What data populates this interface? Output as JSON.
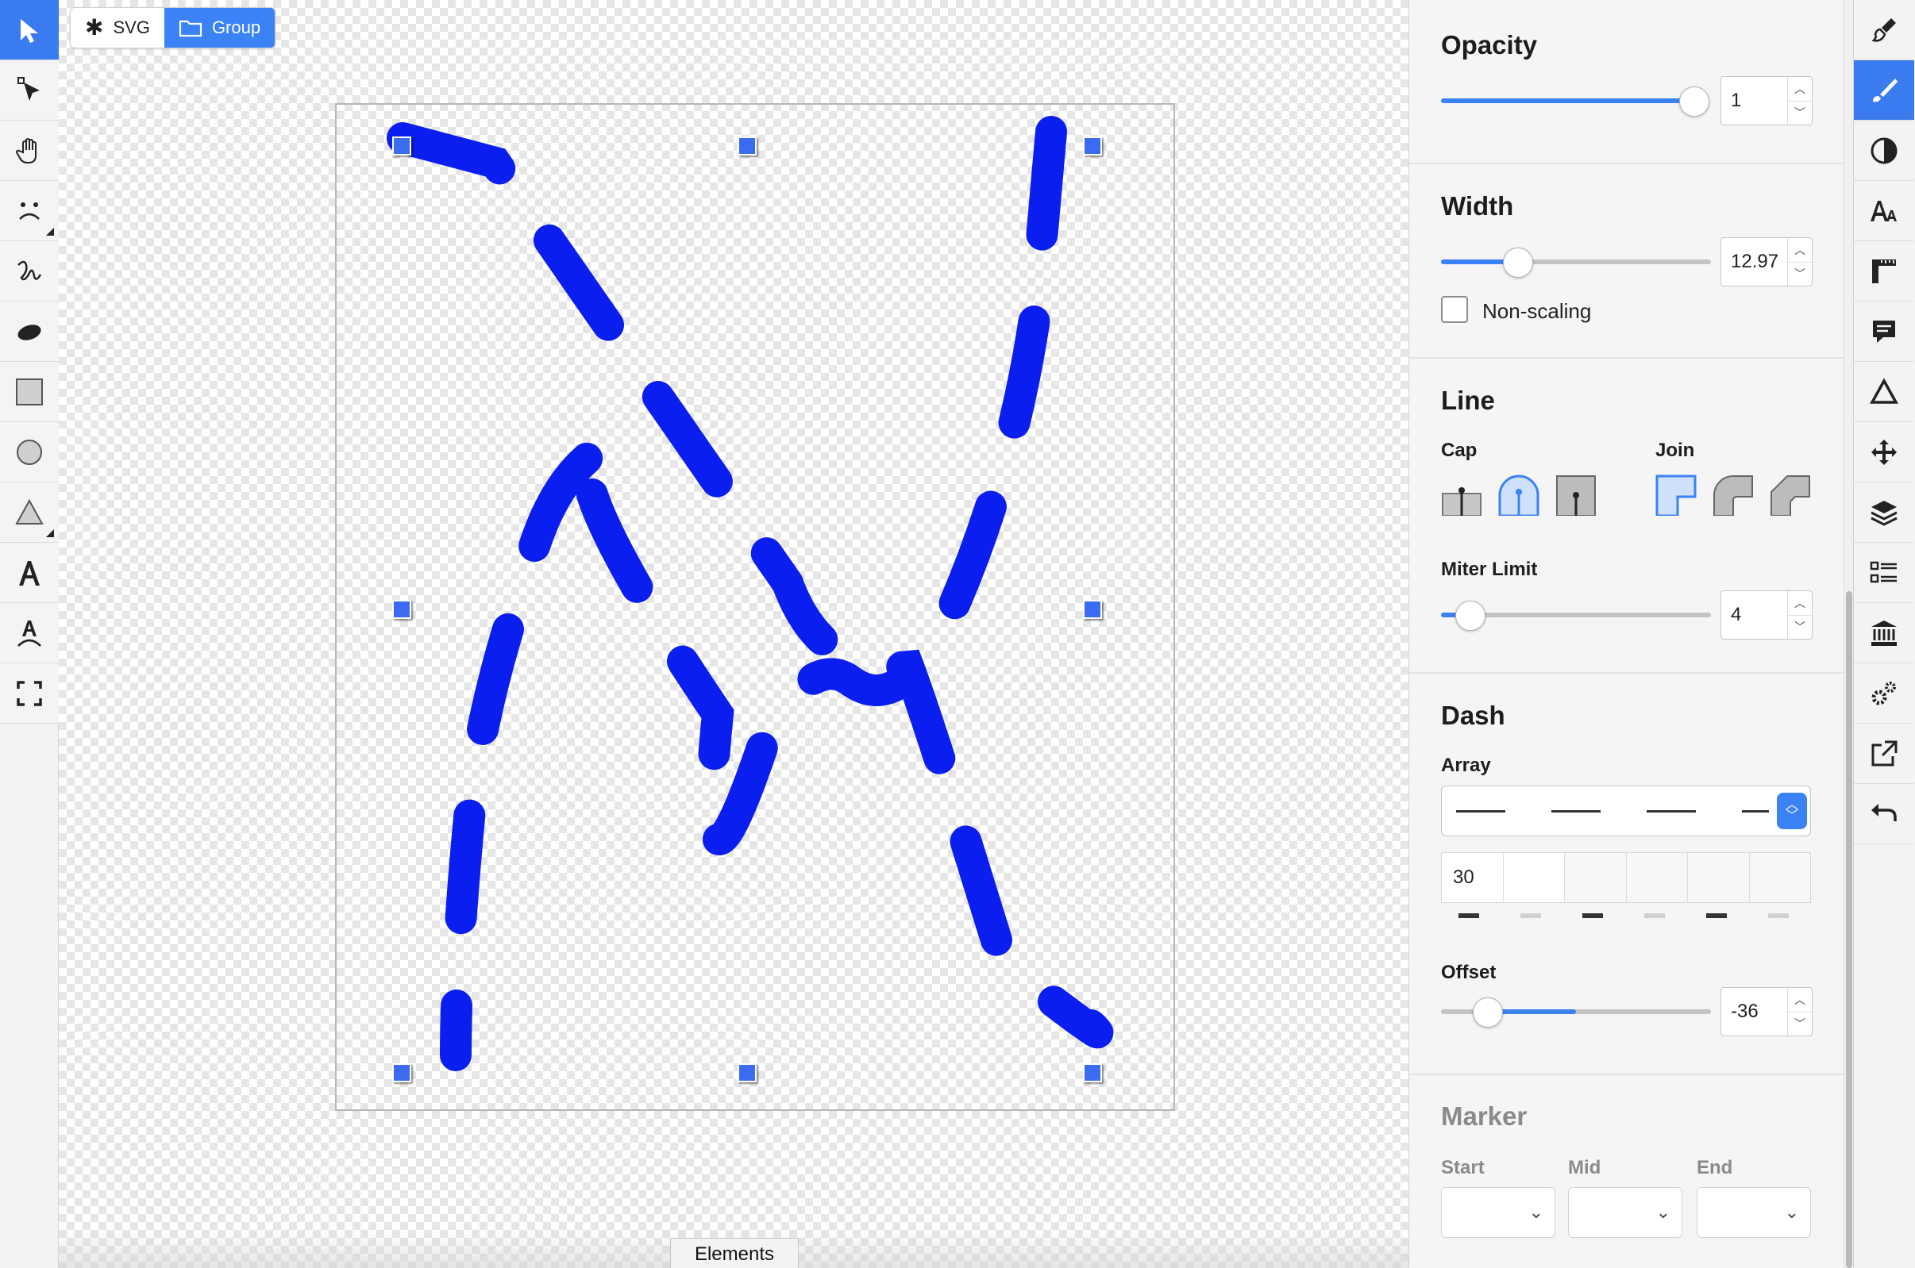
{
  "breadcrumb": {
    "svg_label": "SVG",
    "group_label": "Group"
  },
  "elements_tab": "Elements",
  "left_tools": [
    "select-arrow-icon",
    "node-select-icon",
    "hand-icon",
    "face-icon",
    "freehand-icon",
    "ellipse-icon",
    "rectangle-icon",
    "circle-icon",
    "triangle-icon",
    "text-icon",
    "text-on-path-icon",
    "fullscreen-icon"
  ],
  "right_tools": [
    "brush-fill-icon",
    "brush-stroke-icon",
    "contrast-icon",
    "font-size-icon",
    "ruler-icon",
    "comment-icon",
    "delta-icon",
    "move-icon",
    "layers-icon",
    "list-icon",
    "bank-icon",
    "gears-icon",
    "export-icon",
    "undo-icon"
  ],
  "stroke_color": "#0a1ef0",
  "accent_color": "#3b82f6",
  "opacity": {
    "title": "Opacity",
    "value": "1",
    "level": 1.0
  },
  "width": {
    "title": "Width",
    "value": "12.97",
    "level": 0.28,
    "nonscaling_label": "Non-scaling",
    "nonscaling_checked": false
  },
  "line": {
    "title": "Line",
    "cap_label": "Cap",
    "join_label": "Join",
    "caps": [
      "butt",
      "round",
      "square"
    ],
    "cap_selected": "round",
    "joins": [
      "miter",
      "round",
      "bevel"
    ],
    "join_selected": "miter",
    "miter_label": "Miter Limit",
    "miter_value": "4",
    "miter_level": 0.1
  },
  "dash": {
    "title": "Dash",
    "array_label": "Array",
    "array_values": [
      "30",
      "",
      "",
      "",
      "",
      ""
    ],
    "offset_label": "Offset",
    "offset_value": "-36",
    "offset_level": 0.18
  },
  "marker": {
    "title": "Marker",
    "start_label": "Start",
    "mid_label": "Mid",
    "end_label": "End"
  }
}
